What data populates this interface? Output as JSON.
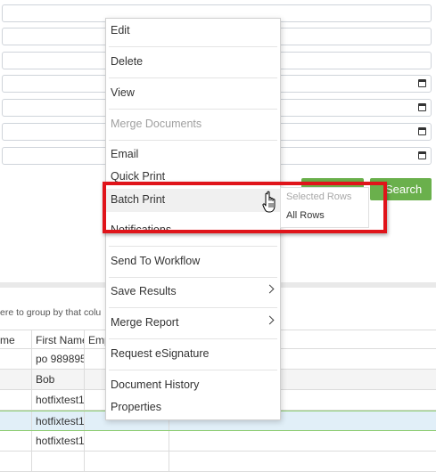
{
  "form": {
    "search_label": "Search",
    "fields": [
      {
        "type": "text",
        "calendar": false
      },
      {
        "type": "text",
        "calendar": false
      },
      {
        "type": "text",
        "calendar": false
      },
      {
        "type": "date",
        "calendar": true
      },
      {
        "type": "date",
        "calendar": true
      },
      {
        "type": "date",
        "calendar": true
      },
      {
        "type": "date",
        "calendar": true
      }
    ]
  },
  "grid": {
    "group_hint": "ere to group by that colu",
    "columns": [
      "me",
      "First Name",
      "Emp"
    ],
    "rows": [
      {
        "first_name": "po 989895",
        "state": "normal"
      },
      {
        "first_name": "Bob",
        "state": "alt"
      },
      {
        "first_name": "hotfixtest1",
        "state": "normal"
      },
      {
        "first_name": "hotfixtest1",
        "state": "selected"
      },
      {
        "first_name": "hotfixtest1",
        "state": "normal"
      },
      {
        "first_name": "",
        "state": "normal"
      }
    ]
  },
  "context_menu": {
    "items": [
      {
        "label": "Edit"
      },
      {
        "label": "Delete"
      },
      {
        "label": "View"
      },
      {
        "label": "Merge Documents",
        "disabled": true
      },
      {
        "label": "Email"
      },
      {
        "label": "Quick Print"
      },
      {
        "label": "Batch Print",
        "hovered": true
      },
      {
        "label": "Notifications"
      },
      {
        "label": "Send To Workflow"
      },
      {
        "label": "Save Results",
        "has_submenu": true
      },
      {
        "label": "Merge Report",
        "has_submenu": true
      },
      {
        "label": "Request eSignature"
      },
      {
        "label": "Document History"
      },
      {
        "label": "Properties"
      }
    ]
  },
  "submenu": {
    "selected_rows": "Selected Rows",
    "all_rows": "All Rows"
  },
  "colors": {
    "accent_green": "#6ab04c",
    "highlight_red": "#e0141a",
    "selected_row": "#e1eff8"
  }
}
